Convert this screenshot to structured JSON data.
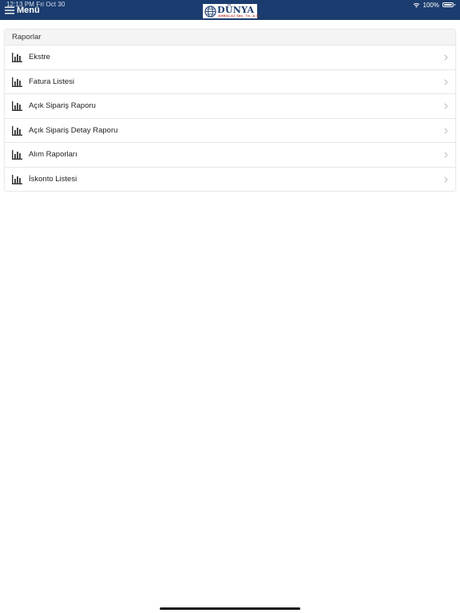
{
  "status_bar": {
    "time": "12:13 PM   Fri Oct 30",
    "battery": "100%"
  },
  "navbar": {
    "menu_label": "Menü",
    "logo_text": "DÜNYA",
    "logo_subtext": "AMBALAJ San. Tic. A.Ş.",
    "background_color": "#1b3c6e"
  },
  "reports": {
    "section_title": "Raporlar",
    "items": [
      {
        "label": "Ekstre",
        "icon": "bar-chart-icon"
      },
      {
        "label": "Fatura Listesi",
        "icon": "bar-chart-icon"
      },
      {
        "label": "Açık Sipariş Raporu",
        "icon": "bar-chart-icon"
      },
      {
        "label": "Açık Sipariş Detay Raporu",
        "icon": "bar-chart-icon"
      },
      {
        "label": "Alım Raporları",
        "icon": "bar-chart-icon"
      },
      {
        "label": "İskonto Listesi",
        "icon": "bar-chart-icon"
      }
    ]
  }
}
